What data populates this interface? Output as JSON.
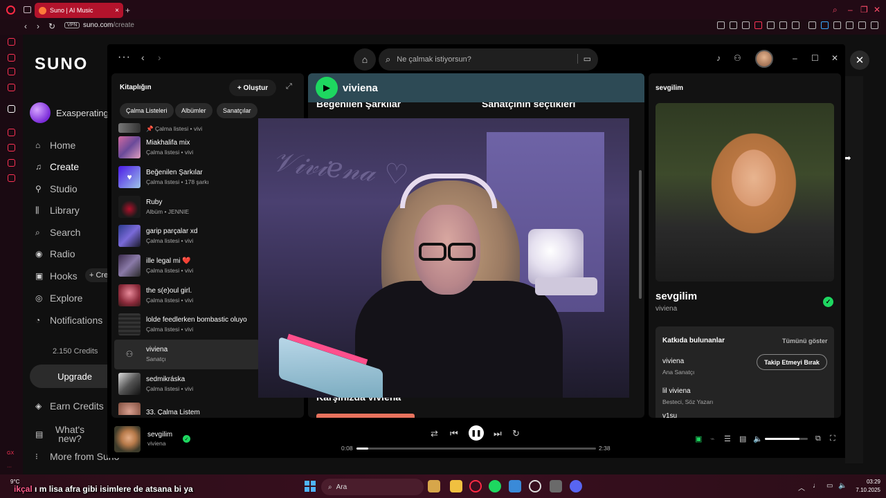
{
  "browser": {
    "tab_title": "Suno | AI Music",
    "tab_close": "×",
    "new_tab": "+",
    "vpn_badge": "VPN",
    "url_host": "suno.com",
    "url_path": "/create"
  },
  "suno": {
    "logo": "SUNO",
    "username": "ExasperatingSc",
    "nav": [
      "Home",
      "Create",
      "Studio",
      "Library",
      "Search",
      "Radio",
      "Hooks",
      "Explore",
      "Notifications"
    ],
    "hooks_create": "+ Crea",
    "credits": "2.150 Credits",
    "upgrade": "Upgrade",
    "earn_credits": "Earn Credits",
    "whats_new": "What's new?",
    "more_from_suno": "More from Suno"
  },
  "spotify": {
    "search_placeholder": "Ne çalmak istiyorsun?",
    "library_title": "Kitaplığın",
    "create_button": "+ Oluştur",
    "chips": [
      "Çalma Listeleri",
      "Albümler",
      "Sanatçılar"
    ],
    "library_items": [
      {
        "title": "",
        "subtitle": "📌 Çalma listesi • vivi"
      },
      {
        "title": "Miakhalifa mix",
        "subtitle": "Çalma listesi • vivi"
      },
      {
        "title": "Beğenilen Şarkılar",
        "subtitle": "Çalma listesi • 178 şarkı"
      },
      {
        "title": "Ruby",
        "subtitle": "Albüm • JENNIE"
      },
      {
        "title": "garip parçalar xd",
        "subtitle": "Çalma listesi • vivi"
      },
      {
        "title": "ille legal mi ❤️",
        "subtitle": "Çalma listesi • vivi"
      },
      {
        "title": "the s(e)oul girl.",
        "subtitle": "Çalma listesi • vivi"
      },
      {
        "title": "lolde feedlerken bombastic oluyo",
        "subtitle": "Çalma listesi • vivi"
      },
      {
        "title": "viviena",
        "subtitle": "Sanatçı"
      },
      {
        "title": "sedmikráska",
        "subtitle": "Çalma listesi • vivi"
      },
      {
        "title": "33. Çalma Listem",
        "subtitle": ""
      }
    ],
    "main": {
      "artist": "viviena",
      "section_liked": "Beğenilen Şarkılar",
      "section_picks": "Sanatçının seçtikleri",
      "section_meet": "Karşınızda viviena"
    },
    "now_playing_panel": {
      "header": "sevgilim",
      "track": "sevgilim",
      "artist": "viviena",
      "credits_title": "Katkıda bulunanlar",
      "show_all": "Tümünü göster",
      "contributors": [
        {
          "name": "viviena",
          "role": "Ana Sanatçı"
        },
        {
          "name": "lil viviena",
          "role": "Besteci, Söz Yazarı"
        },
        {
          "name": "v1su",
          "role": ""
        }
      ],
      "unfollow": "Takip Etmeyi Bırak"
    },
    "player": {
      "track": "sevgilim",
      "artist": "viviena",
      "elapsed": "0:08",
      "duration": "2:38",
      "progress": 0.05,
      "volume": 0.8
    }
  },
  "taskbar": {
    "weather": "9°C",
    "subtitle_prefix": "ikçal",
    "subtitle": "ı m lisa afra gibi isimlere de atsana bi ya",
    "search": "Ara",
    "time": "03:29",
    "date": "7.10.2025"
  },
  "colors": {
    "spotify_green": "#1ed760",
    "tab_red": "#b3132c",
    "header_teal": "#2d4a55"
  }
}
